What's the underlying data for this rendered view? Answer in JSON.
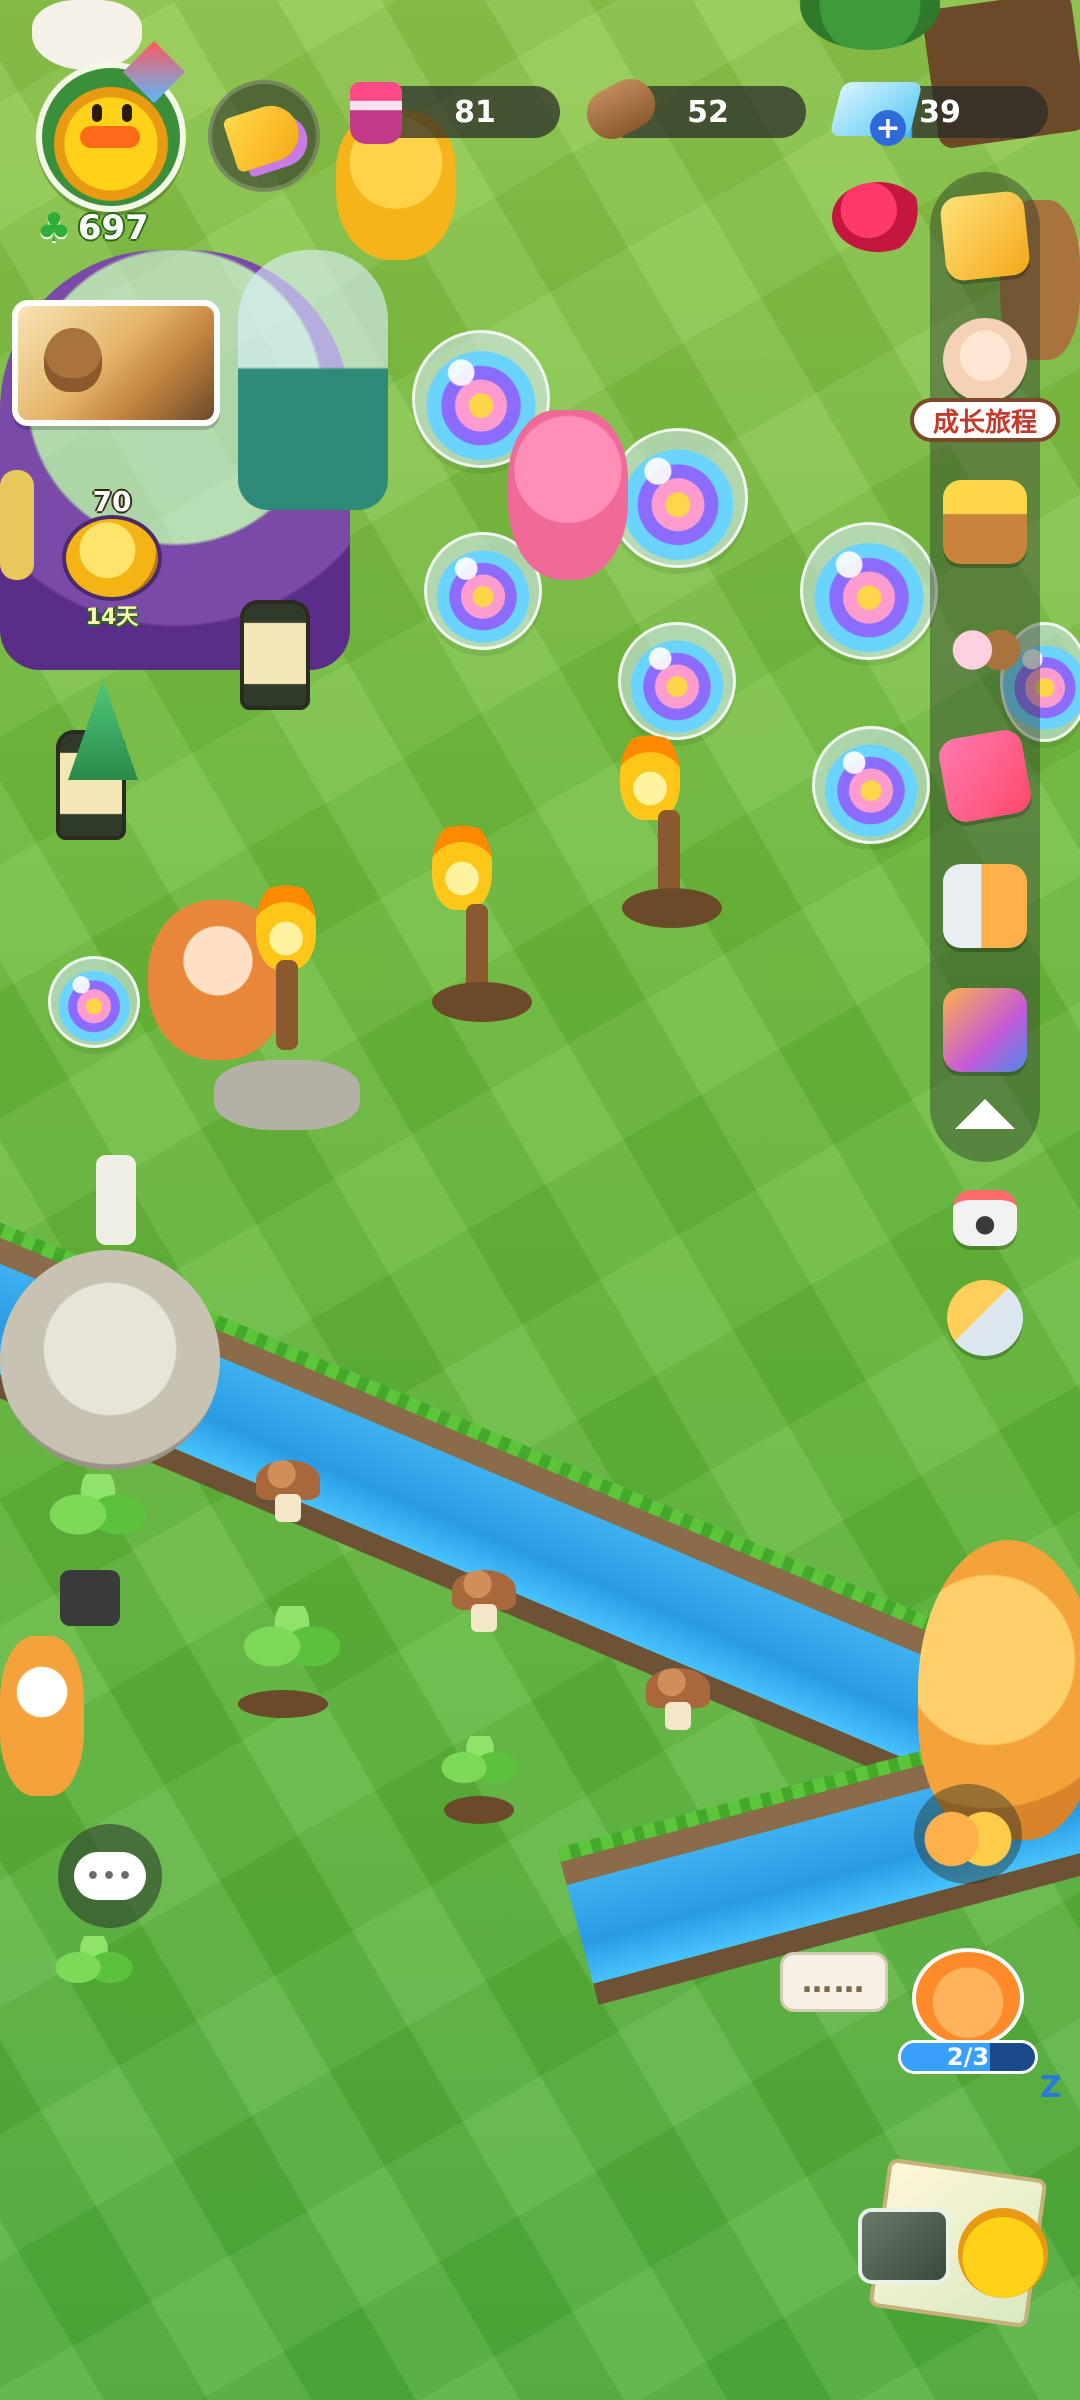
{
  "hud": {
    "clover_count": "697",
    "potion_count": "81",
    "wood_count": "52",
    "gem_count": "39"
  },
  "event_badge": {
    "count": "70",
    "days": "14天"
  },
  "side_panel": {
    "journey_label": "成长旅程"
  },
  "npc_chat": {
    "chat_text": "……",
    "quest_progress_text": "2/3",
    "quest_progress_value": 0.6667
  },
  "thought_bubble": {
    "text": "•••"
  },
  "icons": {
    "clover": "clover-icon",
    "potion": "potion-icon",
    "wood": "wood-log-icon",
    "gem": "gem-icon",
    "add": "plus-icon",
    "megaphone": "megaphone-icon",
    "camera": "camera-icon",
    "phone_swap": "phone-swap-icon",
    "collapse": "chevron-up-icon"
  },
  "colors": {
    "grass": "#6fbf3c",
    "hud_pill": "#2a2a2a",
    "gem_pill_fill": "#4ab8e8",
    "river": "#2a9be4"
  }
}
